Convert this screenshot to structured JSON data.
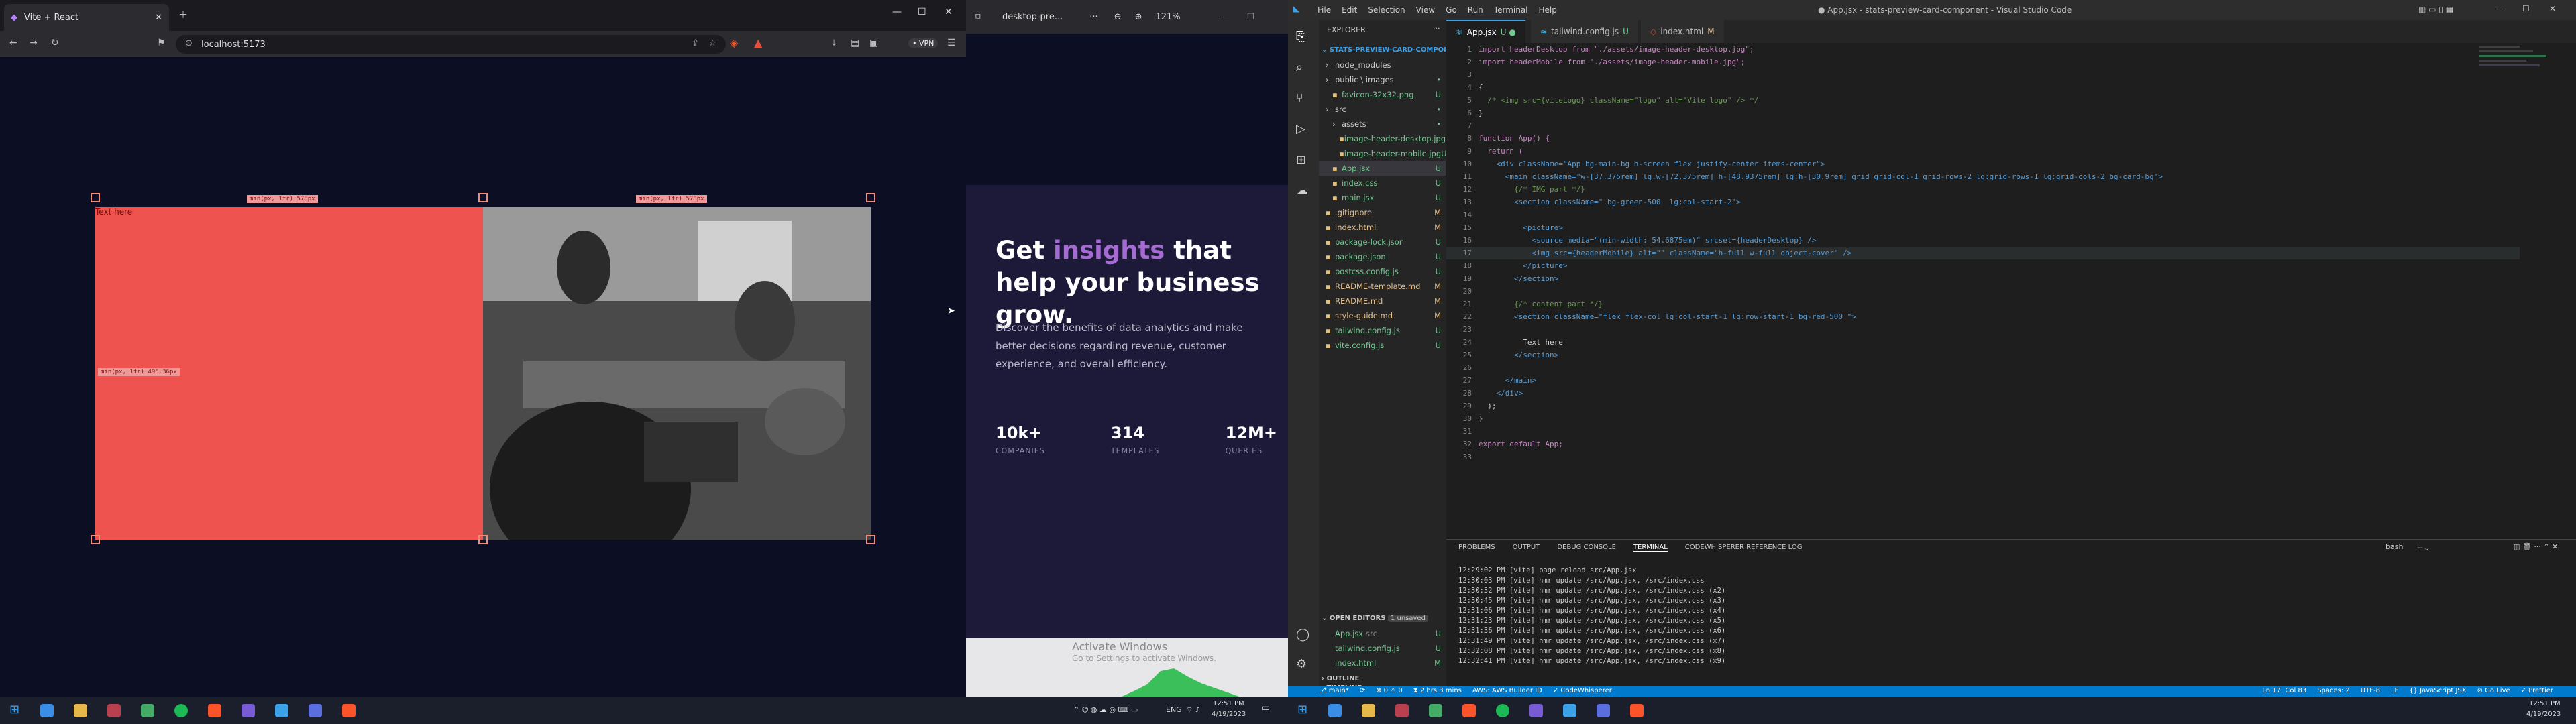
{
  "browser": {
    "tab_title": "Vite + React",
    "url": "localhost:5173",
    "vpn": "• VPN",
    "card_text": "Text here",
    "dim_tags": [
      "min(px, 1fr) 578px",
      "min(px, 1fr) 578px",
      "min(px, 1fr) 496.36px"
    ]
  },
  "preview": {
    "tab_title": "desktop-pre...",
    "zoom": "121%",
    "heading_pre": "Get ",
    "heading_accent": "insights",
    "heading_post": " that help your business grow.",
    "body": "Discover the benefits of data analytics and make better decisions regarding revenue, customer experience, and overall efficiency.",
    "stats": [
      {
        "value": "10k+",
        "label": "COMPANIES"
      },
      {
        "value": "314",
        "label": "TEMPLATES"
      },
      {
        "value": "12M+",
        "label": "QUERIES"
      }
    ],
    "watermark_title": "Activate Windows",
    "watermark_sub": "Go to Settings to activate Windows."
  },
  "vscode": {
    "menu": [
      "File",
      "Edit",
      "Selection",
      "View",
      "Go",
      "Run",
      "Terminal",
      "Help"
    ],
    "title": "● App.jsx - stats-preview-card-component - Visual Studio Code",
    "explorer_label": "EXPLORER",
    "project": "STATS-PREVIEW-CARD-COMPONENT",
    "tree": [
      {
        "name": "node_modules",
        "indent": 1,
        "kind": "folder",
        "badge": ""
      },
      {
        "name": "public \\ images",
        "indent": 1,
        "kind": "folder",
        "badge": "•"
      },
      {
        "name": "favicon-32x32.png",
        "indent": 2,
        "kind": "file",
        "badge": "U"
      },
      {
        "name": "src",
        "indent": 1,
        "kind": "folder",
        "badge": "•"
      },
      {
        "name": "assets",
        "indent": 2,
        "kind": "folder",
        "badge": "•"
      },
      {
        "name": "image-header-desktop.jpg",
        "indent": 3,
        "kind": "file",
        "badge": "U"
      },
      {
        "name": "image-header-mobile.jpg",
        "indent": 3,
        "kind": "file",
        "badge": "U"
      },
      {
        "name": "App.jsx",
        "indent": 2,
        "kind": "file",
        "badge": "U"
      },
      {
        "name": "index.css",
        "indent": 2,
        "kind": "file",
        "badge": "U"
      },
      {
        "name": "main.jsx",
        "indent": 2,
        "kind": "file",
        "badge": "U"
      },
      {
        "name": ".gitignore",
        "indent": 1,
        "kind": "file",
        "badge": "M"
      },
      {
        "name": "index.html",
        "indent": 1,
        "kind": "file",
        "badge": "M"
      },
      {
        "name": "package-lock.json",
        "indent": 1,
        "kind": "file",
        "badge": "U"
      },
      {
        "name": "package.json",
        "indent": 1,
        "kind": "file",
        "badge": "U"
      },
      {
        "name": "postcss.config.js",
        "indent": 1,
        "kind": "file",
        "badge": "U"
      },
      {
        "name": "README-template.md",
        "indent": 1,
        "kind": "file",
        "badge": "M"
      },
      {
        "name": "README.md",
        "indent": 1,
        "kind": "file",
        "badge": "M"
      },
      {
        "name": "style-guide.md",
        "indent": 1,
        "kind": "file",
        "badge": "M"
      },
      {
        "name": "tailwind.config.js",
        "indent": 1,
        "kind": "file",
        "badge": "U"
      },
      {
        "name": "vite.config.js",
        "indent": 1,
        "kind": "file",
        "badge": "U"
      }
    ],
    "open_editors_label": "OPEN EDITORS",
    "unsaved": "1 unsaved",
    "open_editors": [
      {
        "name": "App.jsx",
        "path": "src",
        "badge": "U"
      },
      {
        "name": "tailwind.config.js",
        "path": "",
        "badge": "U"
      },
      {
        "name": "index.html",
        "path": "",
        "badge": "M"
      }
    ],
    "outline": "OUTLINE",
    "timeline": "TIMELINE",
    "tabs": [
      {
        "name": "App.jsx",
        "state": "U ●"
      },
      {
        "name": "tailwind.config.js",
        "state": "U"
      },
      {
        "name": "index.html",
        "state": "M"
      }
    ],
    "code": [
      "import headerDesktop from \"./assets/image-header-desktop.jpg\";",
      "import headerMobile from \"./assets/image-header-mobile.jpg\";",
      "",
      "{",
      "  /* <img src={viteLogo} className=\"logo\" alt=\"Vite logo\" /> */",
      "}",
      "",
      "function App() {",
      "  return (",
      "    <div className=\"App bg-main-bg h-screen flex justify-center items-center\">",
      "      <main className=\"w-[37.375rem] lg:w-[72.375rem] h-[48.9375rem] lg:h-[30.9rem] grid grid-col-1 grid-rows-2 lg:grid-rows-1 lg:grid-cols-2 bg-card-bg\">",
      "        {/* IMG part */}",
      "        <section className=\" bg-green-500  lg:col-start-2\">",
      "",
      "          <picture>",
      "            <source media=\"(min-width: 54.6875em)\" srcset={headerDesktop} />",
      "            <img src={headerMobile} alt=\"\" className=\"h-full w-full object-cover\" />",
      "          </picture>",
      "        </section>",
      "",
      "        {/* content part */}",
      "        <section className=\"flex flex-col lg:col-start-1 lg:row-start-1 bg-red-500 \">",
      "",
      "          Text here",
      "        </section>",
      "",
      "      </main>",
      "    </div>",
      "  );",
      "}",
      "",
      "export default App;",
      ""
    ],
    "panel_tabs": [
      "PROBLEMS",
      "OUTPUT",
      "DEBUG CONSOLE",
      "TERMINAL",
      "CODEWHISPERER REFERENCE LOG"
    ],
    "terminal_name": "bash",
    "terminal": [
      "12:29:02 PM [vite] page reload src/App.jsx",
      "12:30:03 PM [vite] hmr update /src/App.jsx, /src/index.css",
      "12:30:32 PM [vite] hmr update /src/App.jsx, /src/index.css (x2)",
      "12:30:45 PM [vite] hmr update /src/App.jsx, /src/index.css (x3)",
      "12:31:06 PM [vite] hmr update /src/App.jsx, /src/index.css (x4)",
      "12:31:23 PM [vite] hmr update /src/App.jsx, /src/index.css (x5)",
      "12:31:36 PM [vite] hmr update /src/App.jsx, /src/index.css (x6)",
      "12:31:49 PM [vite] hmr update /src/App.jsx, /src/index.css (x7)",
      "12:32:08 PM [vite] hmr update /src/App.jsx, /src/index.css (x8)",
      "12:32:41 PM [vite] hmr update /src/App.jsx, /src/index.css (x9)"
    ],
    "status_left": [
      "⎇ main*",
      "⟳",
      "⊗ 0 ⚠ 0",
      "⧗ 2 hrs 3 mins",
      "AWS: AWS Builder ID",
      "✓ CodeWhisperer"
    ],
    "status_right": [
      "Ln 17, Col 83",
      "Spaces: 2",
      "UTF-8",
      "LF",
      "{} JavaScript JSX",
      "⊘ Go Live",
      "✓ Prettier"
    ]
  },
  "taskbar": {
    "lang": "ENG",
    "time_left": "12:51 PM",
    "date_left": "4/19/2023",
    "time_right": "12:51 PM",
    "date_right": "4/19/2023"
  },
  "colors": {
    "accent": "#a66bd3",
    "card_red": "#ef5350",
    "vs_blue": "#007acc"
  }
}
